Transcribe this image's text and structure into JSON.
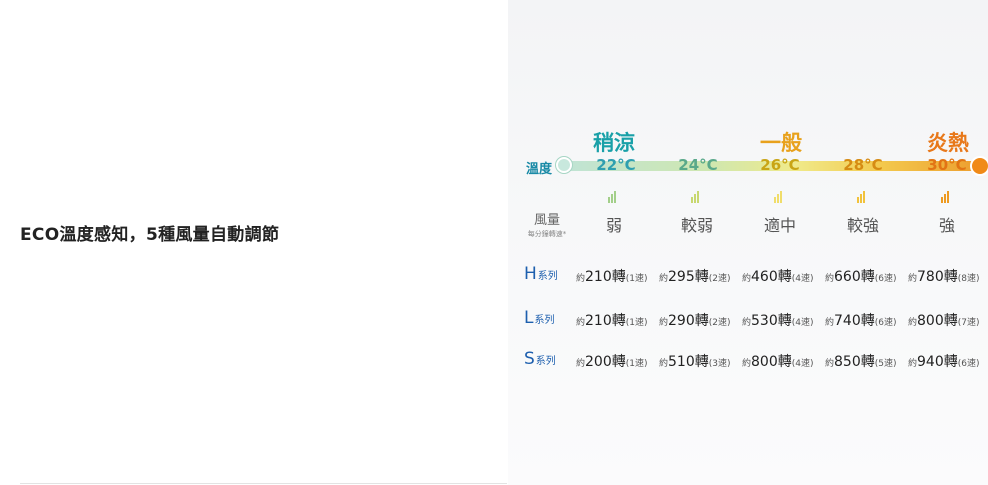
{
  "left": {
    "title": "ECO溫度感知，5種風量自動調節"
  },
  "categories": [
    {
      "label": "稍涼",
      "color": "#19a0a8"
    },
    {
      "label": "一般",
      "color": "#e8a11c"
    },
    {
      "label": "炎熱",
      "color": "#e8781a"
    }
  ],
  "bar_label": "溫度",
  "temps": [
    {
      "label": "22°C",
      "color": "#2f9fb0"
    },
    {
      "label": "24°C",
      "color": "#5aa98a"
    },
    {
      "label": "26°C",
      "color": "#c9a515"
    },
    {
      "label": "28°C",
      "color": "#d68b13"
    },
    {
      "label": "30°C",
      "color": "#e27414"
    }
  ],
  "fan_icon_colors": [
    "#a3cf8a",
    "#c8d870",
    "#f0dd6a",
    "#f1c23c",
    "#ee9b22"
  ],
  "wind_label": {
    "main": "風量",
    "sub": "每分鐘轉速*"
  },
  "wind": [
    "弱",
    "較弱",
    "適中",
    "較強",
    "強"
  ],
  "series": [
    {
      "letter": "H",
      "suffix": "系列",
      "speeds": [
        {
          "prefix": "約",
          "value": "210轉",
          "suffix": "(1速)"
        },
        {
          "prefix": "約",
          "value": "295轉",
          "suffix": "(2速)"
        },
        {
          "prefix": "約",
          "value": "460轉",
          "suffix": "(4速)"
        },
        {
          "prefix": "約",
          "value": "660轉",
          "suffix": "(6速)"
        },
        {
          "prefix": "約",
          "value": "780轉",
          "suffix": "(8速)"
        }
      ]
    },
    {
      "letter": "L",
      "suffix": "系列",
      "speeds": [
        {
          "prefix": "約",
          "value": "210轉",
          "suffix": "(1速)"
        },
        {
          "prefix": "約",
          "value": "290轉",
          "suffix": "(2速)"
        },
        {
          "prefix": "約",
          "value": "530轉",
          "suffix": "(4速)"
        },
        {
          "prefix": "約",
          "value": "740轉",
          "suffix": "(6速)"
        },
        {
          "prefix": "約",
          "value": "800轉",
          "suffix": "(7速)"
        }
      ]
    },
    {
      "letter": "S",
      "suffix": "系列",
      "speeds": [
        {
          "prefix": "約",
          "value": "200轉",
          "suffix": "(1速)"
        },
        {
          "prefix": "約",
          "value": "510轉",
          "suffix": "(3速)"
        },
        {
          "prefix": "約",
          "value": "800轉",
          "suffix": "(4速)"
        },
        {
          "prefix": "約",
          "value": "850轉",
          "suffix": "(5速)"
        },
        {
          "prefix": "約",
          "value": "940轉",
          "suffix": "(6速)"
        }
      ]
    }
  ]
}
